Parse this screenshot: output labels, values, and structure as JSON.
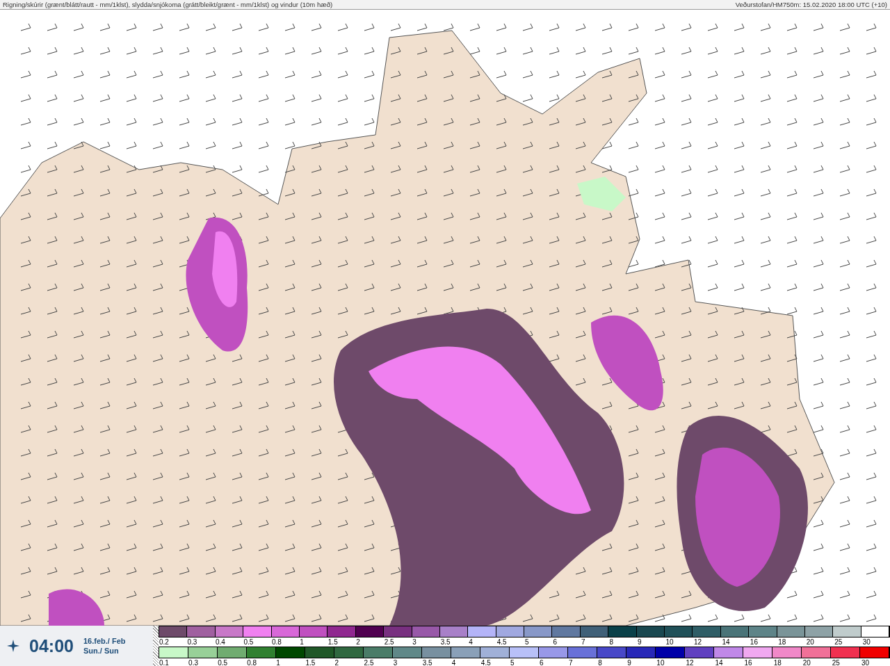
{
  "header": {
    "title": "Rigning/skúrir (grænt/blátt/rautt - mm/1klst), slydda/snjókoma (grátt/bleikt/grænt - mm/1klst) og vindur (10m hæð)",
    "source": "Veðurstofan/HM750m: 15.02.2020 18:00 UTC (+10)"
  },
  "time_box": {
    "time": "04:00",
    "date": "16.feb./ Feb",
    "day": "Sun./ Sun"
  },
  "legends": [
    {
      "items": [
        {
          "label": "0.2",
          "color": "#6e4a6a"
        },
        {
          "label": "0.3",
          "color": "#a060a0"
        },
        {
          "label": "0.4",
          "color": "#c878c8"
        },
        {
          "label": "0.5",
          "color": "#f080f0"
        },
        {
          "label": "0.8",
          "color": "#d868d8"
        },
        {
          "label": "1",
          "color": "#c050c0"
        },
        {
          "label": "1.5",
          "color": "#902890"
        },
        {
          "label": "2",
          "color": "#500050"
        },
        {
          "label": "2.5",
          "color": "#783080"
        },
        {
          "label": "3",
          "color": "#9858a8"
        },
        {
          "label": "3.5",
          "color": "#a880c8"
        },
        {
          "label": "4",
          "color": "#b4b4f8"
        },
        {
          "label": "4.5",
          "color": "#a0a8e0"
        },
        {
          "label": "5",
          "color": "#8898c8"
        },
        {
          "label": "6",
          "color": "#6078a0"
        },
        {
          "label": "7",
          "color": "#406078"
        },
        {
          "label": "8",
          "color": "#0a4048"
        },
        {
          "label": "9",
          "color": "#1a4850"
        },
        {
          "label": "10",
          "color": "#205058"
        },
        {
          "label": "12",
          "color": "#2f5e66"
        },
        {
          "label": "14",
          "color": "#4a7478"
        },
        {
          "label": "16",
          "color": "#5e8488"
        },
        {
          "label": "18",
          "color": "#7a9498"
        },
        {
          "label": "20",
          "color": "#8ea2a6"
        },
        {
          "label": "25",
          "color": "#c0cccc"
        },
        {
          "label": "30",
          "color": "#ffffff"
        }
      ]
    },
    {
      "items": [
        {
          "label": "0.1",
          "color": "#c8f8c8"
        },
        {
          "label": "0.3",
          "color": "#98d098"
        },
        {
          "label": "0.5",
          "color": "#70ac70"
        },
        {
          "label": "0.8",
          "color": "#308030"
        },
        {
          "label": "1",
          "color": "#004800"
        },
        {
          "label": "1.5",
          "color": "#205828"
        },
        {
          "label": "2",
          "color": "#306840"
        },
        {
          "label": "2.5",
          "color": "#4a7c68"
        },
        {
          "label": "3",
          "color": "#608888"
        },
        {
          "label": "3.5",
          "color": "#7890a0"
        },
        {
          "label": "4",
          "color": "#8aa0b8"
        },
        {
          "label": "4.5",
          "color": "#a0b0d8"
        },
        {
          "label": "5",
          "color": "#b8c0f8"
        },
        {
          "label": "6",
          "color": "#9898e8"
        },
        {
          "label": "7",
          "color": "#6870d8"
        },
        {
          "label": "8",
          "color": "#4848c8"
        },
        {
          "label": "9",
          "color": "#2828b8"
        },
        {
          "label": "10",
          "color": "#0000a8"
        },
        {
          "label": "12",
          "color": "#6040c0"
        },
        {
          "label": "14",
          "color": "#c088e8"
        },
        {
          "label": "16",
          "color": "#f0a8f0"
        },
        {
          "label": "18",
          "color": "#f088c8"
        },
        {
          "label": "20",
          "color": "#f07098"
        },
        {
          "label": "25",
          "color": "#f03050"
        },
        {
          "label": "30",
          "color": "#f00000"
        }
      ]
    }
  ]
}
